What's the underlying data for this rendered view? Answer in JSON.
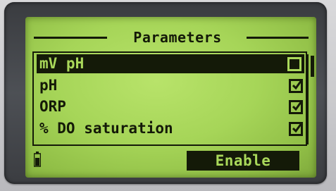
{
  "screen": {
    "title": "Parameters"
  },
  "parameters": [
    {
      "label": "mV pH",
      "checked": false,
      "selected": true
    },
    {
      "label": "pH",
      "checked": true,
      "selected": false
    },
    {
      "label": "ORP",
      "checked": true,
      "selected": false
    },
    {
      "label": "% DO saturation",
      "checked": true,
      "selected": false
    }
  ],
  "softkey": {
    "label": "Enable"
  },
  "icons": {
    "battery": "battery-icon",
    "checkbox": "checkbox-icon",
    "checkmark": "checkmark-icon"
  },
  "colors": {
    "lcd_background": "#a6d558",
    "lcd_ink": "#141a08",
    "bezel": "#45484d"
  }
}
